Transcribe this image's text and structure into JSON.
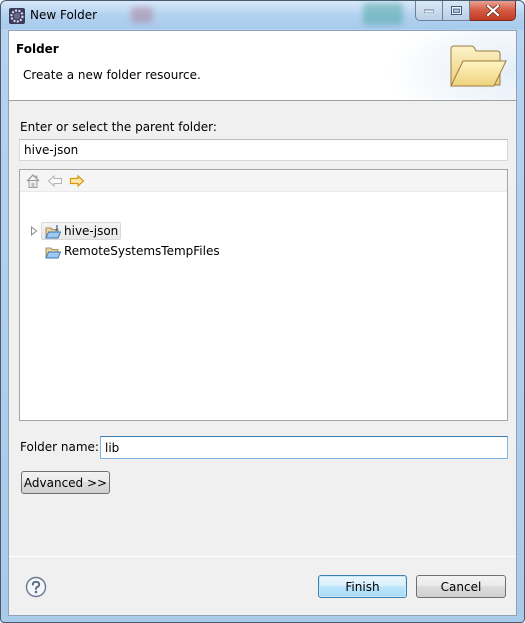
{
  "window": {
    "title": "New Folder",
    "controls": {
      "minimize": "minimize",
      "maximize": "maximize",
      "close": "close"
    }
  },
  "banner": {
    "title": "Folder",
    "description": "Create a new folder resource.",
    "icon": "open-folder-icon"
  },
  "parent": {
    "label": "Enter or select the parent folder:",
    "value": "hive-json"
  },
  "tree": {
    "toolbar": [
      "home-icon",
      "back-arrow-icon",
      "forward-arrow-icon"
    ],
    "items": [
      {
        "label": "hive-json",
        "expandable": true,
        "selected": true,
        "icon": "java-project-folder-icon"
      },
      {
        "label": "RemoteSystemsTempFiles",
        "expandable": false,
        "selected": false,
        "icon": "project-folder-icon"
      }
    ]
  },
  "folder_name": {
    "label": "Folder name:",
    "value": "lib"
  },
  "buttons": {
    "advanced": "Advanced >>",
    "finish": "Finish",
    "cancel": "Cancel",
    "help": "help-icon"
  },
  "colors": {
    "titlebar": "#b3d2f0",
    "client_bg": "#f0f0f0",
    "close_red": "#c23b22",
    "focus_border": "#3c7fb1",
    "forward_arrow": "#e8a81c"
  }
}
